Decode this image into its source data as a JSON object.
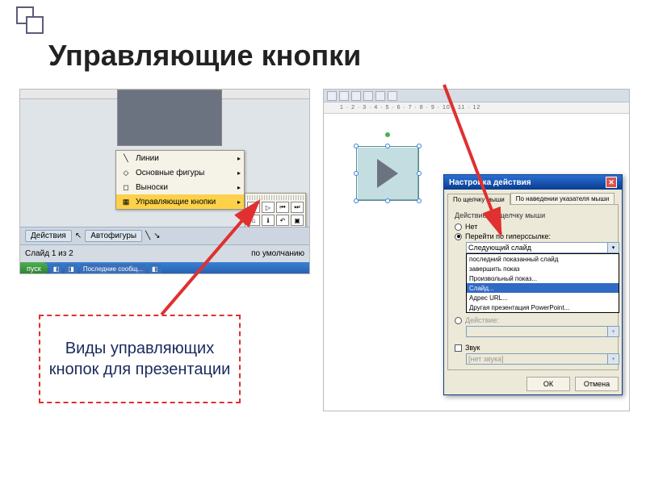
{
  "title": "Управляющие кнопки",
  "callout": "Виды управляющих кнопок для презентации",
  "left": {
    "menu": {
      "items": [
        {
          "label": "Линии"
        },
        {
          "label": "Основные фигуры"
        },
        {
          "label": "Выноски"
        },
        {
          "label": "Управляющие кнопки"
        }
      ]
    },
    "toolbar1": {
      "actions": "Действия",
      "autoshapes": "Автофигуры"
    },
    "toolbar2": {
      "slide_of": "Слайд 1 из 2",
      "default": "по умолчанию"
    },
    "taskbar": {
      "start": "пуск",
      "item1": "Последние сообщ..."
    }
  },
  "right": {
    "ruler_ticks": "1 · 2 · 3 · 4 · 5 · 6 · 7 · 8 · 9 · 10 · 11 · 12",
    "dialog": {
      "title": "Настройка действия",
      "tab1": "По щелчку мыши",
      "tab2": "По наведении указателя мыши",
      "group_label": "Действие по щелчку мыши",
      "radio_none": "Нет",
      "radio_hyperlink": "Перейти по гиперссылке:",
      "combo_value": "Следующий слайд",
      "dropdown_options": [
        "последний показанный слайд",
        "завершить показ",
        "Произвольный показ...",
        "Слайд...",
        "Адрес URL...",
        "Другая презентация PowerPoint..."
      ],
      "selected_option_index": 3,
      "radio_action": "Действие:",
      "check_sound": "Звук",
      "sound_value": "[нет звука]",
      "btn_ok": "ОК",
      "btn_cancel": "Отмена"
    }
  }
}
